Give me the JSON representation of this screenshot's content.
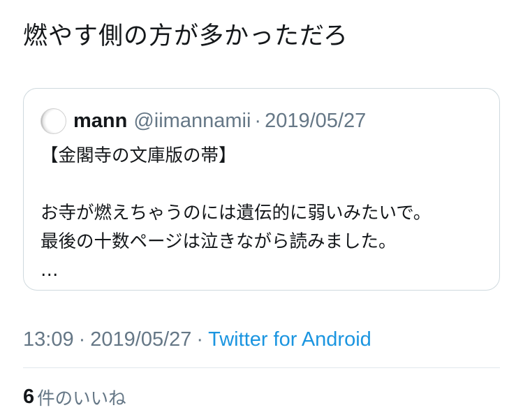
{
  "tweet": {
    "text": "燃やす側の方が多かっただろ"
  },
  "quote": {
    "author_name": "mann",
    "author_handle": "@iimannamii",
    "separator": "·",
    "date": "2019/05/27",
    "lines": [
      "【金閣寺の文庫版の帯】",
      "",
      "お寺が燃えちゃうのには遺伝的に弱いみたいで。",
      "最後の十数ページは泣きながら読みました。",
      "…"
    ]
  },
  "meta": {
    "time": "13:09",
    "separator": "·",
    "date": "2019/05/27",
    "source": "Twitter for Android"
  },
  "likes": {
    "count": "6",
    "label": "件のいいね"
  },
  "colors": {
    "text_primary": "#14171a",
    "text_secondary": "#657786",
    "link": "#1b95e0",
    "border": "#cfd9de"
  }
}
